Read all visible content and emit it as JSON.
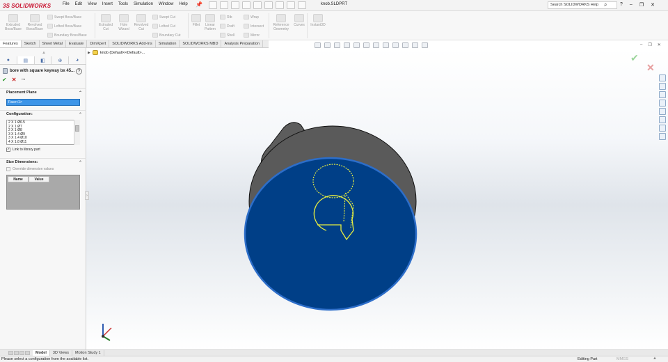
{
  "app": {
    "logo_prefix": "3S",
    "logo_text": "SOLIDWORKS",
    "document_title": "knob.SLDPRT",
    "search_placeholder": "Search SOLIDWORKS Help",
    "menus": [
      "File",
      "Edit",
      "View",
      "Insert",
      "Tools",
      "Simulation",
      "Window",
      "Help"
    ]
  },
  "commands": {
    "extruded_boss": "Extruded\nBoss/Base",
    "revolved_boss": "Revolved\nBoss/Base",
    "swept_boss": "Swept Boss/Base",
    "lofted_boss": "Lofted Boss/Base",
    "boundary_boss": "Boundary Boss/Base",
    "extruded_cut": "Extruded\nCut",
    "hole_wizard": "Hole\nWizard",
    "revolved_cut": "Revolved\nCut",
    "swept_cut": "Swept Cut",
    "lofted_cut": "Lofted Cut",
    "boundary_cut": "Boundary Cut",
    "fillet": "Fillet",
    "linear_pattern": "Linear\nPattern",
    "rib": "Rib",
    "draft": "Draft",
    "shell": "Shell",
    "wrap": "Wrap",
    "intersect": "Intersect",
    "mirror": "Mirror",
    "reference_geometry": "Reference\nGeometry",
    "curves": "Curves",
    "instant3d": "Instant3D"
  },
  "tabs": [
    "Features",
    "Sketch",
    "Sheet Metal",
    "Evaluate",
    "DimXpert",
    "SOLIDWORKS Add-Ins",
    "Simulation",
    "SOLIDWORKS MBD",
    "Analysis Preparation"
  ],
  "active_tab": "Features",
  "tree": {
    "label": "knob  (Default<<Default>..."
  },
  "property_manager": {
    "title": "bore with square keyway bx 45...",
    "help": "?",
    "placement_plane": {
      "header": "Placement Plane",
      "value": "Face<1>"
    },
    "configuration": {
      "header": "Configuration:",
      "items": [
        "2 X 1  Ø6.5",
        "2 X 1  Ø7",
        "2 X 1  Ø8",
        "3 X 1.4  Ø9",
        "3 X 1.4  Ø10",
        "4 X 1.8  Ø11"
      ],
      "link_label": "Link to library part",
      "link_checked": true
    },
    "size_dimensions": {
      "header": "Size Dimensions:",
      "override_label": "Override dimension values",
      "override_checked": false,
      "columns": [
        "Name",
        "Value"
      ]
    }
  },
  "bottom_tabs": [
    "Model",
    "3D Views",
    "Motion Study 1"
  ],
  "active_bottom_tab": "Model",
  "status": {
    "message": "Please select a configuration from the available list.",
    "mode": "Editing Part",
    "units": "MMGS"
  },
  "colors": {
    "face_blue": "#003f87",
    "body_gray": "#5a5a5a",
    "preview_yellow": "#e8f040",
    "selection_field": "#3d95e8"
  }
}
